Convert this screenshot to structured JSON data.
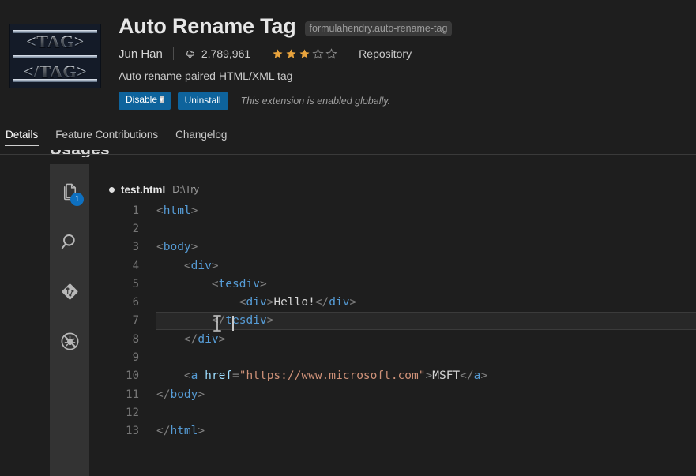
{
  "extension": {
    "name": "Auto Rename Tag",
    "identifier": "formulahendry.auto-rename-tag",
    "publisher": "Jun Han",
    "installs": "2,789,961",
    "install_icon": "cloud-download-icon",
    "rating_stars_filled": 3,
    "rating_stars_total": 5,
    "repository_label": "Repository",
    "description": "Auto rename paired HTML/XML tag",
    "disable_label": "Disable",
    "disable_caret": "▾",
    "uninstall_label": "Uninstall",
    "status_text": "This extension is enabled globally.",
    "logo_line1": "<TAG>",
    "logo_line2": "</TAG>",
    "accent_blue": "#0e639c",
    "star_color": "#e8a33d",
    "badge_color": "#0e70c0"
  },
  "tabs": [
    {
      "label": "Details",
      "active": true
    },
    {
      "label": "Feature Contributions",
      "active": false
    },
    {
      "label": "Changelog",
      "active": false
    }
  ],
  "content": {
    "section_heading": "Usages"
  },
  "activity_bar": {
    "items": [
      {
        "icon": "files-explorer-icon",
        "badge": "1"
      },
      {
        "icon": "search-icon",
        "badge": null
      },
      {
        "icon": "source-control-icon",
        "badge": null
      },
      {
        "icon": "run-and-debug-icon",
        "badge": null
      }
    ]
  },
  "editor": {
    "file_name": "test.html",
    "file_path": "D:\\Try",
    "dirty": true,
    "cursor_line": 7,
    "lines": [
      {
        "n": "1",
        "indent": 0,
        "segments": [
          {
            "t": "<",
            "c": "tk-punct"
          },
          {
            "t": "html",
            "c": "tk-tag"
          },
          {
            "t": ">",
            "c": "tk-punct"
          }
        ]
      },
      {
        "n": "2",
        "indent": 0,
        "segments": []
      },
      {
        "n": "3",
        "indent": 0,
        "segments": [
          {
            "t": "<",
            "c": "tk-punct"
          },
          {
            "t": "body",
            "c": "tk-tag"
          },
          {
            "t": ">",
            "c": "tk-punct"
          }
        ]
      },
      {
        "n": "4",
        "indent": 1,
        "segments": [
          {
            "t": "<",
            "c": "tk-punct"
          },
          {
            "t": "div",
            "c": "tk-tag"
          },
          {
            "t": ">",
            "c": "tk-punct"
          }
        ]
      },
      {
        "n": "5",
        "indent": 2,
        "segments": [
          {
            "t": "<",
            "c": "tk-punct"
          },
          {
            "t": "tesdiv",
            "c": "tk-tag"
          },
          {
            "t": ">",
            "c": "tk-punct"
          }
        ]
      },
      {
        "n": "6",
        "indent": 3,
        "segments": [
          {
            "t": "<",
            "c": "tk-punct"
          },
          {
            "t": "div",
            "c": "tk-tag"
          },
          {
            "t": ">",
            "c": "tk-punct"
          },
          {
            "t": "Hello!",
            "c": "tk-text"
          },
          {
            "t": "</",
            "c": "tk-punct"
          },
          {
            "t": "div",
            "c": "tk-tag"
          },
          {
            "t": ">",
            "c": "tk-punct"
          }
        ]
      },
      {
        "n": "7",
        "indent": 2,
        "segments": [
          {
            "t": "</",
            "c": "tk-punct"
          },
          {
            "t": "tesdiv",
            "c": "tk-tag"
          },
          {
            "t": ">",
            "c": "tk-punct"
          }
        ]
      },
      {
        "n": "8",
        "indent": 1,
        "segments": [
          {
            "t": "</",
            "c": "tk-punct"
          },
          {
            "t": "div",
            "c": "tk-tag"
          },
          {
            "t": ">",
            "c": "tk-punct"
          }
        ]
      },
      {
        "n": "9",
        "indent": 0,
        "segments": []
      },
      {
        "n": "10",
        "indent": 1,
        "segments": [
          {
            "t": "<",
            "c": "tk-punct"
          },
          {
            "t": "a",
            "c": "tk-tag"
          },
          {
            "t": " ",
            "c": "tk-text"
          },
          {
            "t": "href",
            "c": "tk-attr"
          },
          {
            "t": "=",
            "c": "tk-punct"
          },
          {
            "t": "\"",
            "c": "tk-str"
          },
          {
            "t": "https://www.microsoft.com",
            "c": "tk-link"
          },
          {
            "t": "\"",
            "c": "tk-str"
          },
          {
            "t": ">",
            "c": "tk-punct"
          },
          {
            "t": "MSFT",
            "c": "tk-text"
          },
          {
            "t": "</",
            "c": "tk-punct"
          },
          {
            "t": "a",
            "c": "tk-tag"
          },
          {
            "t": ">",
            "c": "tk-punct"
          }
        ]
      },
      {
        "n": "11",
        "indent": 0,
        "segments": [
          {
            "t": "</",
            "c": "tk-punct"
          },
          {
            "t": "body",
            "c": "tk-tag"
          },
          {
            "t": ">",
            "c": "tk-punct"
          }
        ]
      },
      {
        "n": "12",
        "indent": 0,
        "segments": []
      },
      {
        "n": "13",
        "indent": 0,
        "segments": [
          {
            "t": "</",
            "c": "tk-punct"
          },
          {
            "t": "html",
            "c": "tk-tag"
          },
          {
            "t": ">",
            "c": "tk-punct"
          }
        ]
      }
    ]
  }
}
